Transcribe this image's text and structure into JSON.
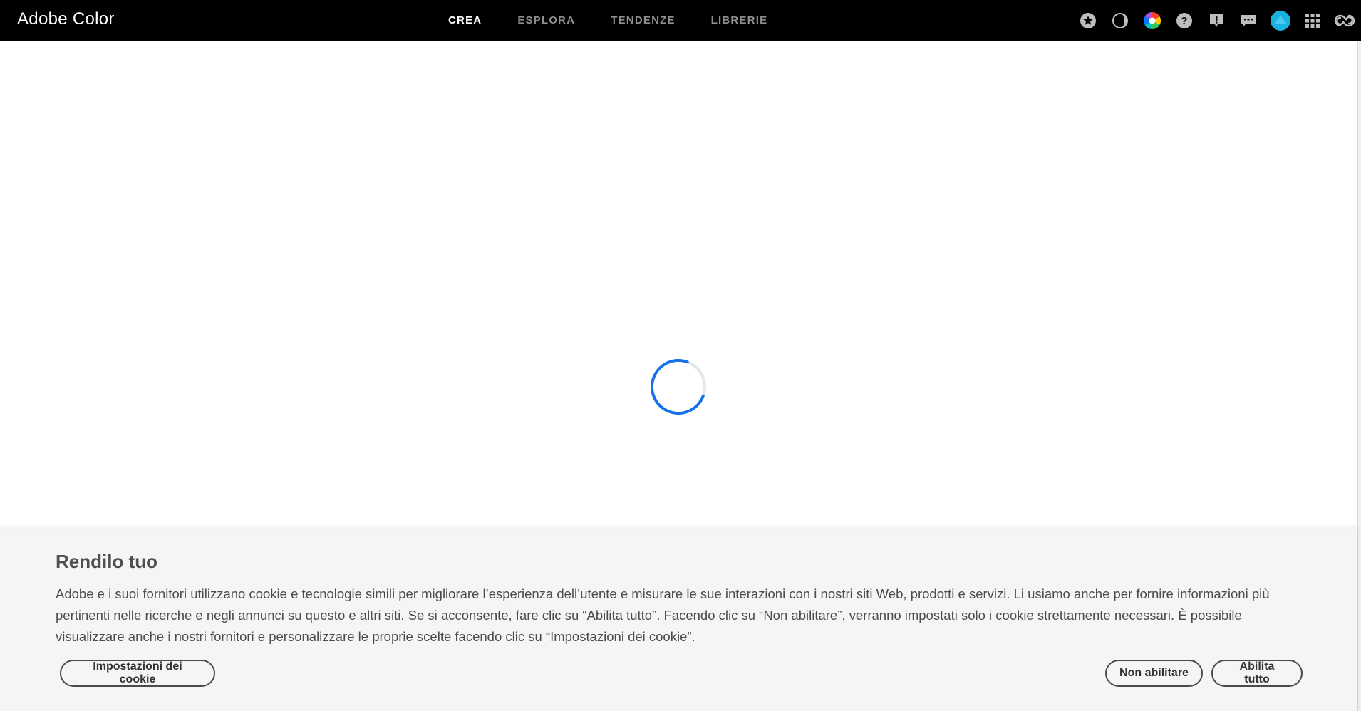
{
  "header": {
    "brand": "Adobe Color",
    "nav": [
      {
        "label": "CREA",
        "active": true
      },
      {
        "label": "ESPLORA",
        "active": false
      },
      {
        "label": "TENDENZE",
        "active": false
      },
      {
        "label": "LIBRERIE",
        "active": false
      }
    ],
    "tools": [
      "star-badge-icon",
      "contrast-icon",
      "color-wheel-icon",
      "help-icon",
      "feedback-alert-icon",
      "chat-icon",
      "user-avatar",
      "apps-grid-icon",
      "creative-cloud-icon"
    ]
  },
  "main": {
    "loading": true,
    "spinner_color": "#1473e6"
  },
  "cookie_banner": {
    "title": "Rendilo tuo",
    "text": "Adobe e i suoi fornitori utilizzano cookie e tecnologie simili per migliorare l’esperienza dell’utente e misurare le sue interazioni con i nostri siti Web, prodotti e servizi. Li usiamo anche per fornire informazioni più pertinenti nelle ricerche e negli annunci su questo e altri siti. Se si acconsente, fare clic su “Abilita tutto”. Facendo clic su “Non abilitare”, verranno impostati solo i cookie strettamente necessari. È possibile visualizzare anche i nostri fornitori e personalizzare le proprie scelte facendo clic su “Impostazioni dei cookie”.",
    "settings_label": "Impostazioni dei cookie",
    "decline_label": "Non abilitare",
    "accept_label": "Abilita tutto"
  },
  "colors": {
    "topbar": "#000000",
    "avatar": "#1ab3e0",
    "banner_bg": "#f5f5f5"
  }
}
